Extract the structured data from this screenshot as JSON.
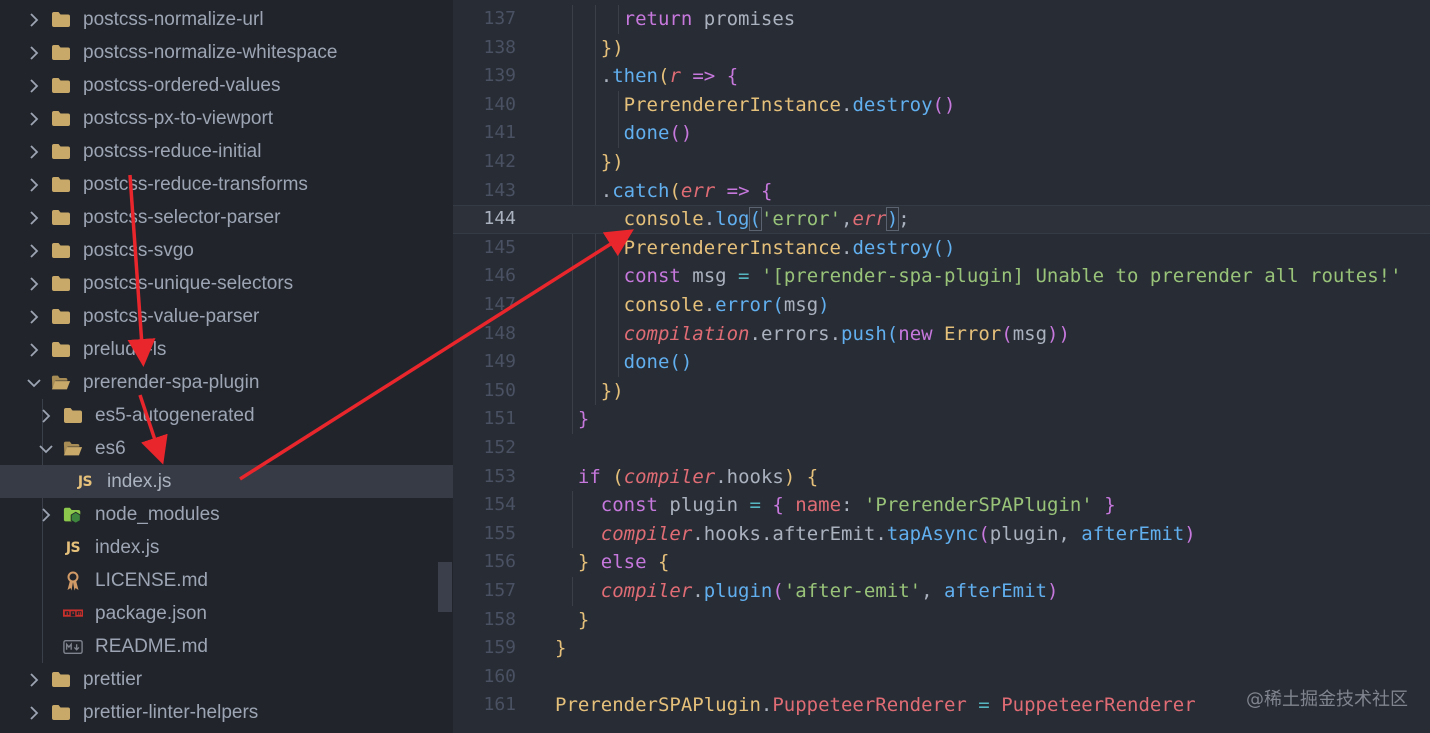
{
  "explorer": {
    "items": [
      {
        "label": "postcss-normalize-url",
        "icon": "folder-icon",
        "expanded": false
      },
      {
        "label": "postcss-normalize-whitespace",
        "icon": "folder-icon",
        "expanded": false
      },
      {
        "label": "postcss-ordered-values",
        "icon": "folder-icon",
        "expanded": false
      },
      {
        "label": "postcss-px-to-viewport",
        "icon": "folder-icon",
        "expanded": false
      },
      {
        "label": "postcss-reduce-initial",
        "icon": "folder-icon",
        "expanded": false
      },
      {
        "label": "postcss-reduce-transforms",
        "icon": "folder-icon",
        "expanded": false
      },
      {
        "label": "postcss-selector-parser",
        "icon": "folder-icon",
        "expanded": false
      },
      {
        "label": "postcss-svgo",
        "icon": "folder-icon",
        "expanded": false
      },
      {
        "label": "postcss-unique-selectors",
        "icon": "folder-icon",
        "expanded": false
      },
      {
        "label": "postcss-value-parser",
        "icon": "folder-icon",
        "expanded": false
      },
      {
        "label": "prelude-ls",
        "icon": "folder-icon",
        "expanded": false
      },
      {
        "label": "prerender-spa-plugin",
        "icon": "folder-open-icon",
        "expanded": true
      },
      {
        "label": "es5-autogenerated",
        "icon": "folder-icon",
        "expanded": false
      },
      {
        "label": "es6",
        "icon": "folder-open-icon",
        "expanded": true
      },
      {
        "label": "index.js",
        "icon": "js-file-icon",
        "badge": "JS",
        "selected": true
      },
      {
        "label": "node_modules",
        "icon": "node-modules-folder-icon",
        "expanded": false
      },
      {
        "label": "index.js",
        "icon": "js-file-icon",
        "badge": "JS"
      },
      {
        "label": "LICENSE.md",
        "icon": "license-file-icon"
      },
      {
        "label": "package.json",
        "icon": "npm-package-icon",
        "badge": "npm"
      },
      {
        "label": "README.md",
        "icon": "markdown-file-icon",
        "badge": "M↓"
      },
      {
        "label": "prettier",
        "icon": "folder-icon",
        "expanded": false
      },
      {
        "label": "prettier-linter-helpers",
        "icon": "folder-icon",
        "expanded": false
      }
    ]
  },
  "editor": {
    "current_line": "144",
    "lines": [
      {
        "n": "137",
        "tokens": [
          [
            "      ",
            "plain"
          ],
          [
            "return",
            "kw"
          ],
          [
            " promises",
            "plain"
          ]
        ]
      },
      {
        "n": "138",
        "tokens": [
          [
            "    ",
            "plain"
          ],
          [
            "})",
            "brkt2"
          ]
        ]
      },
      {
        "n": "139",
        "tokens": [
          [
            "    ",
            "plain"
          ],
          [
            ".",
            "plain"
          ],
          [
            "then",
            "fn"
          ],
          [
            "(",
            "brkt2"
          ],
          [
            "r",
            "vari"
          ],
          [
            " ",
            "plain"
          ],
          [
            "=>",
            "kw"
          ],
          [
            " ",
            "plain"
          ],
          [
            "{",
            "brkt"
          ]
        ]
      },
      {
        "n": "140",
        "tokens": [
          [
            "      ",
            "plain"
          ],
          [
            "PrerendererInstance",
            "cls"
          ],
          [
            ".",
            "plain"
          ],
          [
            "destroy",
            "fn"
          ],
          [
            "()",
            "brkt"
          ]
        ]
      },
      {
        "n": "141",
        "tokens": [
          [
            "      ",
            "plain"
          ],
          [
            "done",
            "fn"
          ],
          [
            "()",
            "brkt"
          ]
        ]
      },
      {
        "n": "142",
        "tokens": [
          [
            "    ",
            "plain"
          ],
          [
            "})",
            "brkt2"
          ]
        ]
      },
      {
        "n": "143",
        "tokens": [
          [
            "    ",
            "plain"
          ],
          [
            ".",
            "plain"
          ],
          [
            "catch",
            "fn"
          ],
          [
            "(",
            "brkt2"
          ],
          [
            "err",
            "vari"
          ],
          [
            " ",
            "plain"
          ],
          [
            "=>",
            "kw"
          ],
          [
            " ",
            "plain"
          ],
          [
            "{",
            "brkt"
          ]
        ]
      },
      {
        "n": "144",
        "tokens": [
          [
            "      ",
            "plain"
          ],
          [
            "console",
            "cls"
          ],
          [
            ".",
            "plain"
          ],
          [
            "log",
            "fn"
          ],
          [
            "(",
            "brkt3"
          ],
          [
            "'error'",
            "str"
          ],
          [
            ",",
            "plain"
          ],
          [
            "err",
            "vari"
          ],
          [
            ")",
            "brkt3"
          ],
          [
            ";",
            "plain"
          ]
        ]
      },
      {
        "n": "145",
        "tokens": [
          [
            "      ",
            "plain"
          ],
          [
            "PrerendererInstance",
            "cls"
          ],
          [
            ".",
            "plain"
          ],
          [
            "destroy",
            "fn"
          ],
          [
            "()",
            "brkt3"
          ]
        ]
      },
      {
        "n": "146",
        "tokens": [
          [
            "      ",
            "plain"
          ],
          [
            "const",
            "kw"
          ],
          [
            " msg ",
            "plain"
          ],
          [
            "=",
            "cyan"
          ],
          [
            " ",
            "plain"
          ],
          [
            "'[prerender-spa-plugin] Unable to prerender all routes!'",
            "str"
          ]
        ]
      },
      {
        "n": "147",
        "tokens": [
          [
            "      ",
            "plain"
          ],
          [
            "console",
            "cls"
          ],
          [
            ".",
            "plain"
          ],
          [
            "error",
            "fn"
          ],
          [
            "(",
            "brkt3"
          ],
          [
            "msg",
            "plain"
          ],
          [
            ")",
            "brkt3"
          ]
        ]
      },
      {
        "n": "148",
        "tokens": [
          [
            "      ",
            "plain"
          ],
          [
            "compilation",
            "vari"
          ],
          [
            ".",
            "plain"
          ],
          [
            "errors",
            "plain"
          ],
          [
            ".",
            "plain"
          ],
          [
            "push",
            "fn"
          ],
          [
            "(",
            "brkt3"
          ],
          [
            "new",
            "kw"
          ],
          [
            " ",
            "plain"
          ],
          [
            "Error",
            "cls"
          ],
          [
            "(",
            "brkt"
          ],
          [
            "msg",
            "plain"
          ],
          [
            "))",
            "brkt"
          ]
        ]
      },
      {
        "n": "149",
        "tokens": [
          [
            "      ",
            "plain"
          ],
          [
            "done",
            "fn"
          ],
          [
            "()",
            "brkt3"
          ]
        ]
      },
      {
        "n": "150",
        "tokens": [
          [
            "    ",
            "plain"
          ],
          [
            "})",
            "brkt2"
          ]
        ]
      },
      {
        "n": "151",
        "tokens": [
          [
            "  ",
            "plain"
          ],
          [
            "}",
            "brkt"
          ]
        ]
      },
      {
        "n": "152",
        "tokens": []
      },
      {
        "n": "153",
        "tokens": [
          [
            "  ",
            "plain"
          ],
          [
            "if",
            "kw"
          ],
          [
            " ",
            "plain"
          ],
          [
            "(",
            "brkt2"
          ],
          [
            "compiler",
            "vari"
          ],
          [
            ".",
            "plain"
          ],
          [
            "hooks",
            "plain"
          ],
          [
            ")",
            "brkt2"
          ],
          [
            " ",
            "plain"
          ],
          [
            "{",
            "brkt2"
          ]
        ]
      },
      {
        "n": "154",
        "tokens": [
          [
            "    ",
            "plain"
          ],
          [
            "const",
            "kw"
          ],
          [
            " plugin ",
            "plain"
          ],
          [
            "=",
            "cyan"
          ],
          [
            " ",
            "plain"
          ],
          [
            "{",
            "brkt"
          ],
          [
            " ",
            "plain"
          ],
          [
            "name",
            "var"
          ],
          [
            ": ",
            "plain"
          ],
          [
            "'PrerenderSPAPlugin'",
            "str"
          ],
          [
            " ",
            "plain"
          ],
          [
            "}",
            "brkt"
          ]
        ]
      },
      {
        "n": "155",
        "tokens": [
          [
            "    ",
            "plain"
          ],
          [
            "compiler",
            "vari"
          ],
          [
            ".",
            "plain"
          ],
          [
            "hooks",
            "plain"
          ],
          [
            ".",
            "plain"
          ],
          [
            "afterEmit",
            "plain"
          ],
          [
            ".",
            "plain"
          ],
          [
            "tapAsync",
            "fn"
          ],
          [
            "(",
            "brkt"
          ],
          [
            "plugin",
            "plain"
          ],
          [
            ", ",
            "plain"
          ],
          [
            "afterEmit",
            "fn"
          ],
          [
            ")",
            "brkt"
          ]
        ]
      },
      {
        "n": "156",
        "tokens": [
          [
            "  ",
            "plain"
          ],
          [
            "}",
            "brkt2"
          ],
          [
            " ",
            "plain"
          ],
          [
            "else",
            "kw"
          ],
          [
            " ",
            "plain"
          ],
          [
            "{",
            "brkt2"
          ]
        ]
      },
      {
        "n": "157",
        "tokens": [
          [
            "    ",
            "plain"
          ],
          [
            "compiler",
            "vari"
          ],
          [
            ".",
            "plain"
          ],
          [
            "plugin",
            "fn"
          ],
          [
            "(",
            "brkt"
          ],
          [
            "'after-emit'",
            "str"
          ],
          [
            ", ",
            "plain"
          ],
          [
            "afterEmit",
            "fn"
          ],
          [
            ")",
            "brkt"
          ]
        ]
      },
      {
        "n": "158",
        "tokens": [
          [
            "  ",
            "plain"
          ],
          [
            "}",
            "brkt2"
          ]
        ]
      },
      {
        "n": "159",
        "tokens": [
          [
            "}",
            "brkt2"
          ]
        ]
      },
      {
        "n": "160",
        "tokens": []
      },
      {
        "n": "161",
        "tokens": [
          [
            "PrerenderSPAPlugin",
            "cls"
          ],
          [
            ".",
            "plain"
          ],
          [
            "PuppeteerRenderer",
            "var"
          ],
          [
            " ",
            "plain"
          ],
          [
            "=",
            "cyan"
          ],
          [
            " ",
            "plain"
          ],
          [
            "PuppeteerRenderer",
            "var"
          ]
        ]
      }
    ]
  },
  "watermark": "@稀土掘金技术社区",
  "colors": {
    "arrow": "#e8262c",
    "folder": "#c8a96a",
    "js_badge": "#e5c07b",
    "selected_row": "#363b45"
  }
}
